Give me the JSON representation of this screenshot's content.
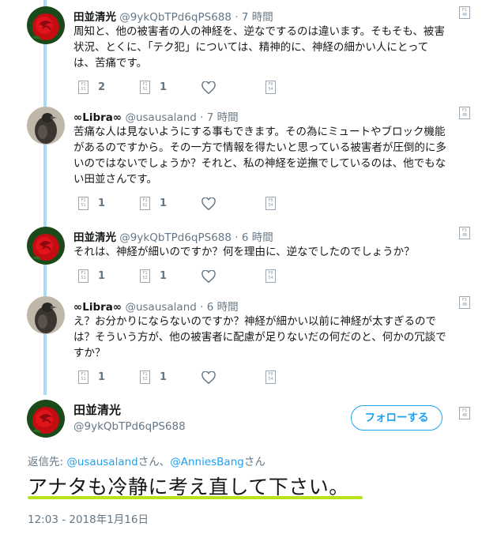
{
  "replies": [
    {
      "name": "田並清光",
      "handle": "@9ykQbTPd6qPS688",
      "time": "7 時間",
      "text": [
        "周知と、他の被害者の人の神経を、逆なでするのは違います。そもそも、被害",
        "状況、とくに、「テク犯」については、精神的に、神経の細かい人にとって",
        "は、苦痛です。"
      ],
      "reply_count": "2",
      "retweet_count": "1",
      "avatar": "red-rose"
    },
    {
      "name": "∞Libra∞",
      "handle": "@usausaland",
      "time": "7 時間",
      "text": [
        "苦痛な人は見ないようにする事もできます。その為にミュートやブロック機能",
        "があるのですから。その一方で情報を得たいと思っている被害者が圧倒的に多",
        "いのではないでしょうか？それと、私の神経を逆撫でしているのは、他でもな",
        "い田並さんです。"
      ],
      "reply_count": "1",
      "retweet_count": "1",
      "avatar": "dark-bird"
    },
    {
      "name": "田並清光",
      "handle": "@9ykQbTPd6qPS688",
      "time": "6 時間",
      "text": [
        "それは、神経が細いのですか？何を理由に、逆なでしたのでしょうか？"
      ],
      "reply_count": "1",
      "retweet_count": "1",
      "avatar": "red-rose"
    },
    {
      "name": "∞Libra∞",
      "handle": "@usausaland",
      "time": "6 時間",
      "text": [
        "え？お分かりにならないのですか？神経が細かい以前に神経が太すぎるので",
        "は？そういう方が、他の被害者に配慮が足りないだの何だのと、何かの冗談で",
        "すか？"
      ],
      "reply_count": "1",
      "retweet_count": "1",
      "avatar": "dark-bird"
    }
  ],
  "tofu_glyphs": {
    "caret": [
      "F1",
      "4B"
    ],
    "reply": [
      "F1",
      "51"
    ],
    "retweet": [
      "F1",
      "52"
    ],
    "share": [
      "F0",
      "54"
    ]
  },
  "main_tweet": {
    "name": "田並清光",
    "handle": "@9ykQbTPd6qPS688",
    "follow_label": "フォローする",
    "reply_to_prefix": "返信先: ",
    "reply_to_user1": "@usausaland",
    "reply_to_san1": "さん、",
    "reply_to_user2": "@AnniesBang",
    "reply_to_san2": "さん",
    "text": "アナタも冷静に考え直して下さい。",
    "timestamp": "12:03 - 2018年1月16日"
  },
  "colors": {
    "accent": "#1da1f2",
    "thread_line": "#a7dcf6",
    "highlight": "#b9e21c",
    "secondary_text": "#657786"
  }
}
